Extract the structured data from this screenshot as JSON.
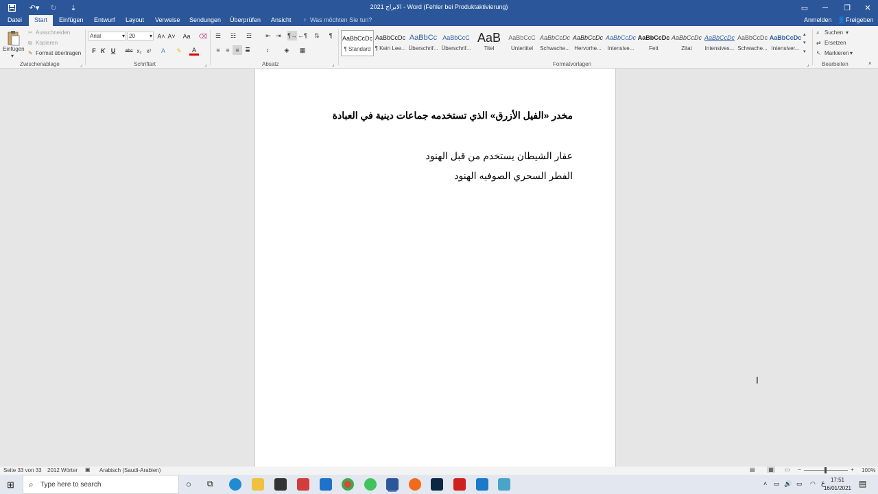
{
  "titlebar": {
    "title": "الابراج 2021 - Word (Fehler bei Produktaktivierung)",
    "qat_more": "⇣"
  },
  "tabs": {
    "items": [
      "Datei",
      "Start",
      "Einfügen",
      "Entwurf",
      "Layout",
      "Verweise",
      "Sendungen",
      "Überprüfen",
      "Ansicht"
    ],
    "tell_me": "Was möchten Sie tun?",
    "sign_in": "Anmelden",
    "share": "Freigeben"
  },
  "ribbon": {
    "clipboard": {
      "paste": "Einfügen",
      "cut": "Ausschneiden",
      "copy": "Kopieren",
      "format_painter": "Format übertragen",
      "label": "Zwischenablage"
    },
    "font": {
      "family": "Arial",
      "size": "20",
      "label": "Schriftart",
      "bold": "F",
      "italic": "K",
      "underline": "U",
      "strike": "abc",
      "sub": "x₂",
      "sup": "x²",
      "grow": "A˄",
      "shrink": "A˅",
      "case": "Aa"
    },
    "paragraph": {
      "label": "Absatz"
    },
    "styles": {
      "label": "Formatvorlagen",
      "items": [
        {
          "preview": "AaBbCcDc",
          "name": "¶ Standard"
        },
        {
          "preview": "AaBbCcDc",
          "name": "¶ Kein Lee..."
        },
        {
          "preview": "AaBbCc",
          "name": "Überschrif..."
        },
        {
          "preview": "AaBbCcC",
          "name": "Überschrif..."
        },
        {
          "preview": "AaB",
          "name": "Titel"
        },
        {
          "preview": "AaBbCcC",
          "name": "Untertitel"
        },
        {
          "preview": "AaBbCcDc",
          "name": "Schwache..."
        },
        {
          "preview": "AaBbCcDc",
          "name": "Hervorhe..."
        },
        {
          "preview": "AaBbCcDc",
          "name": "Intensive..."
        },
        {
          "preview": "AaBbCcDc",
          "name": "Fett"
        },
        {
          "preview": "AaBbCcDc",
          "name": "Zitat"
        },
        {
          "preview": "AaBbCcDc",
          "name": "Intensives..."
        },
        {
          "preview": "AaBbCcDc",
          "name": "Schwache..."
        },
        {
          "preview": "AaBbCcDc",
          "name": "Intensiver..."
        }
      ]
    },
    "editing": {
      "find": "Suchen",
      "replace": "Ersetzen",
      "select": "Markieren",
      "label": "Bearbeiten"
    }
  },
  "document": {
    "heading": "مخدر «الفيل الأزرق» الذي تستخدمه جماعات دينية في العبادة",
    "line1": "عقار الشيطان  يستخدم من قبل الهنود",
    "line2": "الفطر السحري الصوفيه الهنود"
  },
  "statusbar": {
    "page": "Seite 33 von 33",
    "words": "2012 Wörter",
    "language": "Arabisch (Saudi-Arabien)",
    "zoom": "100%"
  },
  "taskbar": {
    "search_placeholder": "Type here to search",
    "time": "17:51",
    "date": "16/01/2021",
    "lang": "ع"
  },
  "colors": {
    "accent": "#2b579a",
    "page": "#ffffff",
    "workspace": "#e6e6e6"
  }
}
